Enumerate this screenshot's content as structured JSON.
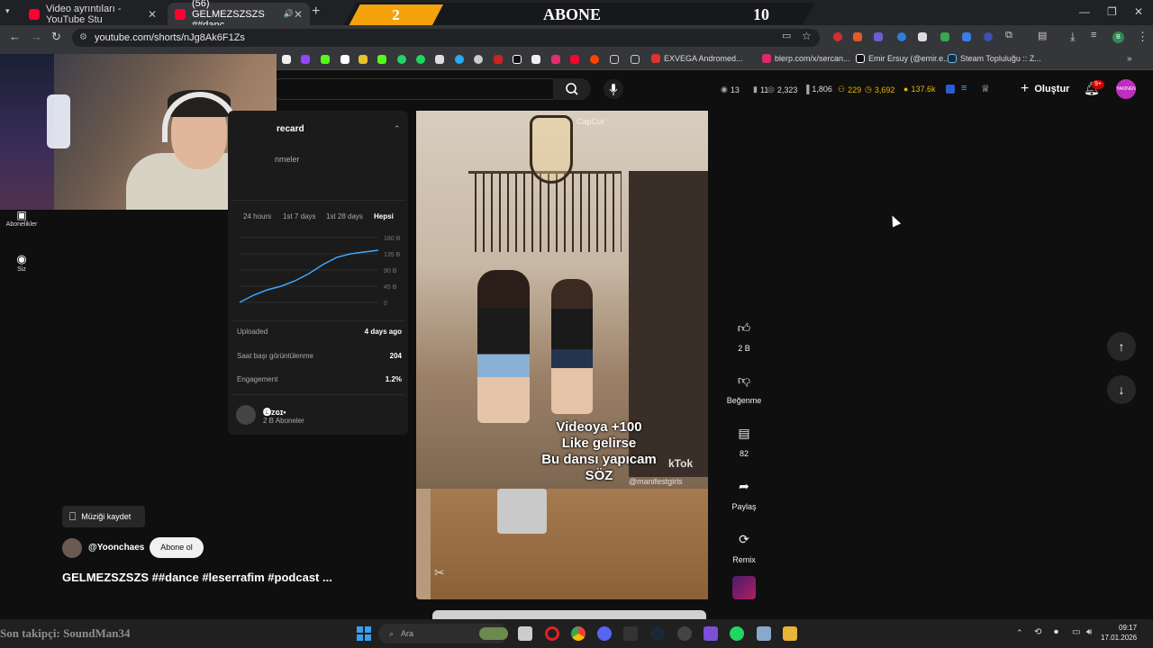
{
  "browser": {
    "tabs": [
      {
        "title": "Video ayrıntıları - YouTube Stu",
        "close": "✕"
      },
      {
        "title": "(56) GELMEZSZSZS ##danc",
        "close": "✕"
      }
    ],
    "new_tab": "+",
    "url": "youtube.com/shorts/nJg8Ak6F1Zs",
    "bookmarks": [
      "EXVEGA Andromed...",
      "blerp.com/x/sercan...",
      "Emir Ersuy (@emir.e...",
      "Steam Topluluğu :: Z..."
    ]
  },
  "stream_banner": {
    "left_number": "2",
    "title": "ABONE",
    "right_number": "10"
  },
  "stream_overlay": {
    "last_follower": "Son takipçi: SoundMan34"
  },
  "header": {
    "stats": [
      "13",
      "11",
      "2,323",
      "1,806",
      "229",
      "3,692",
      "137.6k"
    ],
    "create_label": "Oluştur",
    "notif_badge": "9+",
    "avatar_text": "YAKİNEN"
  },
  "sidebar": {
    "items": [
      {
        "label": "Abonelikler"
      },
      {
        "label": "Siz"
      }
    ]
  },
  "panel": {
    "title": "recard",
    "subtitle": "nmeler",
    "range_tabs": [
      "24 hours",
      "1st 7 days",
      "1st 28 days",
      "Hepsi"
    ],
    "active_tab": "Hepsi",
    "y_ticks": [
      "180 B",
      "135 B",
      "90 B",
      "45 B",
      "0"
    ],
    "rows": [
      {
        "label": "Uploaded",
        "value": "4 days ago"
      },
      {
        "label": "Saat başı görüntülenme",
        "value": "204"
      },
      {
        "label": "Engagement",
        "value": "1.2%"
      }
    ],
    "channel": {
      "name": "🅔ᴢɢɪ•",
      "subs": "2 B Aboneler"
    }
  },
  "chart_data": {
    "type": "line",
    "x": [
      0,
      1,
      2,
      3,
      4,
      5,
      6,
      7,
      8,
      9,
      10
    ],
    "values": [
      0,
      20,
      35,
      45,
      60,
      80,
      105,
      125,
      135,
      140,
      145
    ],
    "ylim": [
      0,
      180
    ],
    "y_ticks": [
      "180 B",
      "135 B",
      "90 B",
      "45 B",
      "0"
    ],
    "color": "#3ea6ff"
  },
  "video": {
    "overlay_text": "Videoya +100\nLike gelirse\nBu dansı yapıcam\nSÖZ",
    "watermark": "CapCut",
    "tiktok": "kTok",
    "handle": "@manifestgirls"
  },
  "actions": {
    "like_count": "2 B",
    "dislike_label": "Beğenme",
    "comments_count": "82",
    "share_label": "Paylaş",
    "remix_label": "Remix"
  },
  "bottom": {
    "save_music": "Müziği kaydet",
    "channel": "@Yoonchaes",
    "subscribe": "Abone ol",
    "title": "GELMEZSZSZS ##dance #leserrafim #podcast ..."
  },
  "taskbar": {
    "search": "Ara",
    "time": "09:17",
    "date": "17.01.2026"
  },
  "colors": {
    "accent": "#3ea6ff",
    "brand": "#ff0033",
    "banner": "#f4a20c"
  }
}
